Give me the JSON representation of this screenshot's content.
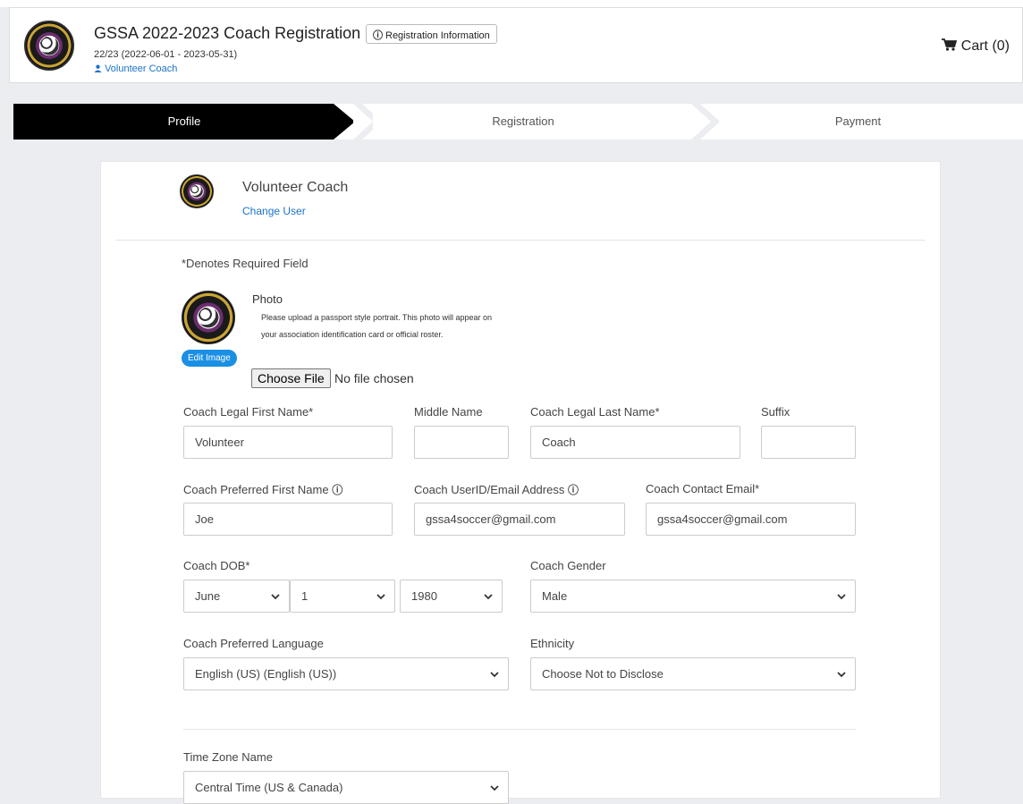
{
  "header": {
    "title": "GSSA 2022-2023 Coach Registration",
    "info_button": "Registration Information",
    "season": "22/23 (2022-06-01 - 2023-05-31)",
    "user": "Volunteer Coach",
    "cart": "Cart (0)"
  },
  "steps": {
    "profile": "Profile",
    "registration": "Registration",
    "payment": "Payment",
    "active": "Profile"
  },
  "profile": {
    "user_name": "Volunteer Coach",
    "change_user": "Change User",
    "required_note": "*Denotes Required Field",
    "photo_label": "Photo",
    "photo_help": "Please upload a passport style portrait. This photo will appear on your association identification card or official roster.",
    "edit_image": "Edit Image",
    "choose_file": "Choose File",
    "file_status": "No file chosen"
  },
  "form": {
    "first_name": {
      "label": "Coach Legal First Name*",
      "value": "Volunteer"
    },
    "middle_name": {
      "label": "Middle Name",
      "value": ""
    },
    "last_name": {
      "label": "Coach Legal Last Name*",
      "value": "Coach"
    },
    "suffix": {
      "label": "Suffix",
      "value": ""
    },
    "preferred_name": {
      "label": "Coach Preferred First Name",
      "value": "Joe"
    },
    "user_email": {
      "label": "Coach UserID/Email Address",
      "value": "gssa4soccer@gmail.com"
    },
    "contact_email": {
      "label": "Coach Contact Email*",
      "value": "gssa4soccer@gmail.com"
    },
    "dob": {
      "label": "Coach DOB*",
      "month": "June",
      "day": "1",
      "year": "1980"
    },
    "gender": {
      "label": "Coach Gender",
      "value": "Male"
    },
    "language": {
      "label": "Coach Preferred Language",
      "value": "English (US) (English (US))"
    },
    "ethnicity": {
      "label": "Ethnicity",
      "value": "Choose Not to Disclose"
    },
    "timezone": {
      "label": "Time Zone Name",
      "value": "Central Time (US & Canada)"
    }
  },
  "icons": {
    "info": "info-circle-icon",
    "cart": "shopping-cart-icon",
    "user": "user-icon",
    "caret": "chevron-down-icon"
  },
  "colors": {
    "accent": "#1a73c8",
    "active_step": "#000000",
    "edit_button": "#1a8fe3"
  }
}
